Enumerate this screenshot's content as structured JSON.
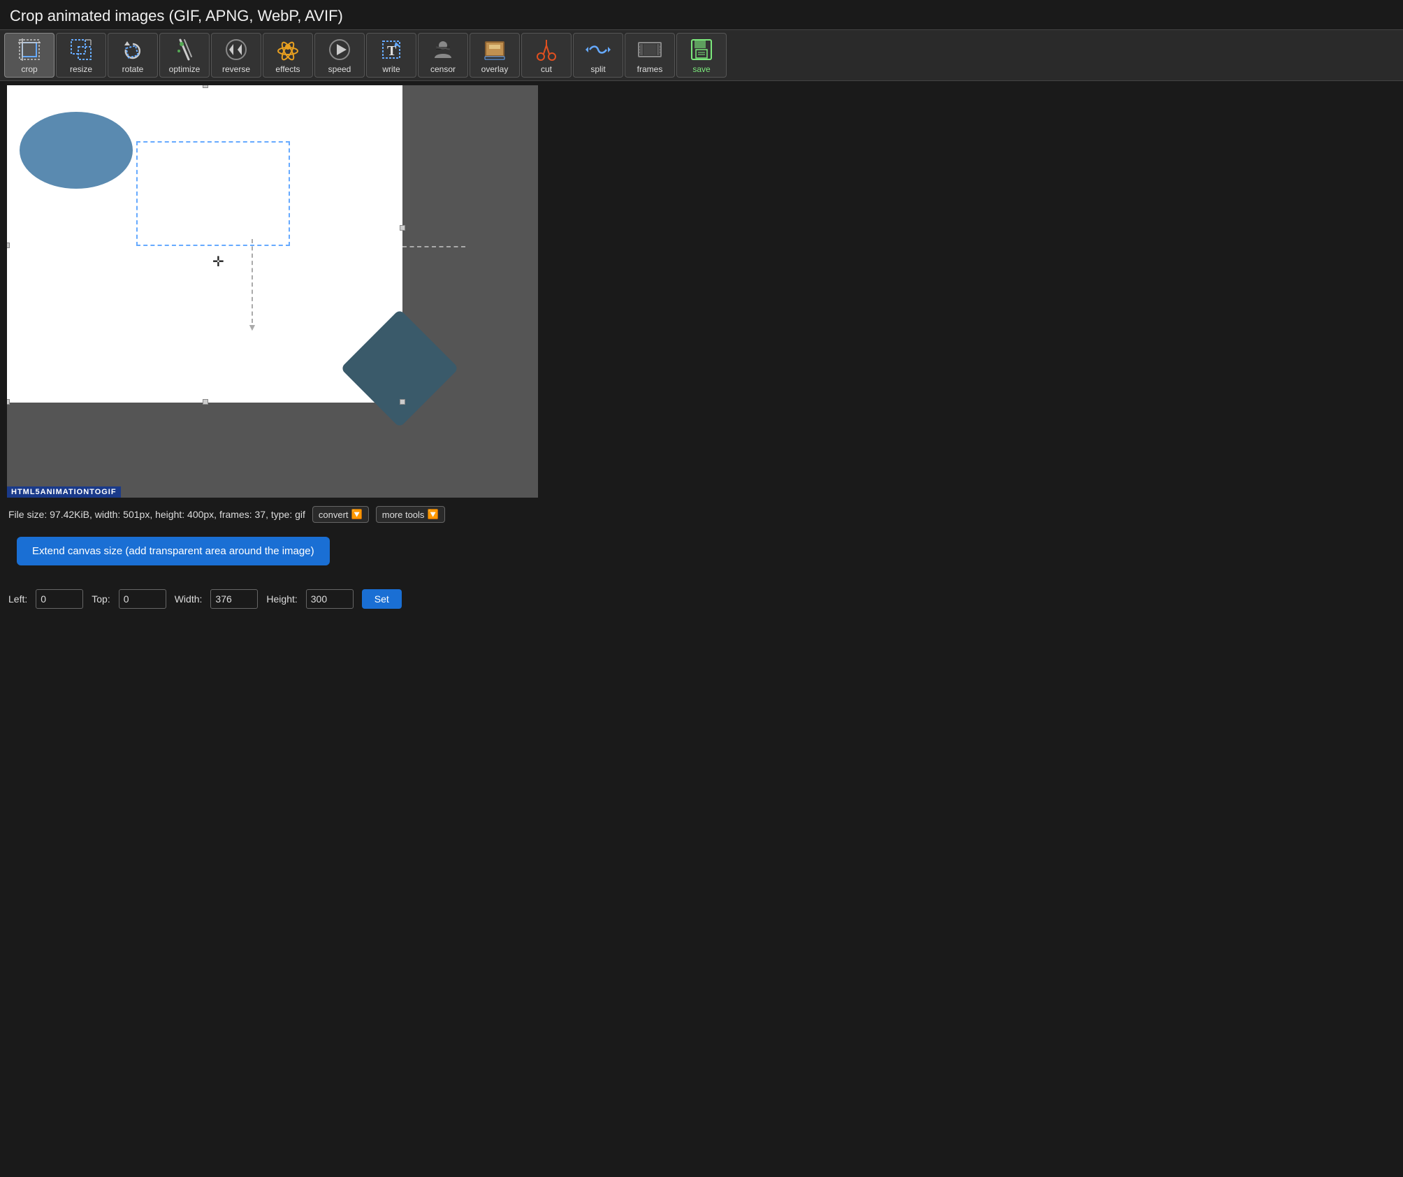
{
  "page": {
    "title": "Crop animated images (GIF, APNG, WebP, AVIF)"
  },
  "toolbar": {
    "tools": [
      {
        "id": "crop",
        "label": "crop",
        "icon": "✂️",
        "active": true
      },
      {
        "id": "resize",
        "label": "resize",
        "icon": "⬜",
        "active": false
      },
      {
        "id": "rotate",
        "label": "rotate",
        "icon": "🔄",
        "active": false
      },
      {
        "id": "optimize",
        "label": "optimize",
        "icon": "🧹",
        "active": false
      },
      {
        "id": "reverse",
        "label": "reverse",
        "icon": "⏮",
        "active": false
      },
      {
        "id": "effects",
        "label": "effects",
        "icon": "💫",
        "active": false
      },
      {
        "id": "speed",
        "label": "speed",
        "icon": "⏱",
        "active": false
      },
      {
        "id": "write",
        "label": "write",
        "icon": "T",
        "active": false
      },
      {
        "id": "censor",
        "label": "censor",
        "icon": "👤",
        "active": false
      },
      {
        "id": "overlay",
        "label": "overlay",
        "icon": "🖼",
        "active": false
      },
      {
        "id": "cut",
        "label": "cut",
        "icon": "✂",
        "active": false
      },
      {
        "id": "split",
        "label": "split",
        "icon": "↔",
        "active": false
      },
      {
        "id": "frames",
        "label": "frames",
        "icon": "🎞",
        "active": false
      },
      {
        "id": "save",
        "label": "save",
        "icon": "💾",
        "active": false
      }
    ]
  },
  "canvas": {
    "gif_label": "HTML5ANIMATIONTOGIF"
  },
  "info_bar": {
    "file_info": "File size: 97.42KiB, width: 501px, height: 400px, frames: 37, type: gif",
    "convert_label": "convert",
    "more_tools_label": "more tools"
  },
  "extend_btn": {
    "label": "Extend canvas size (add transparent area around the image)"
  },
  "controls": {
    "left_label": "Left:",
    "left_value": "0",
    "top_label": "Top:",
    "top_value": "0",
    "width_label": "Width:",
    "width_value": "376",
    "height_label": "Height:",
    "height_value": "300",
    "set_label": "Set"
  }
}
